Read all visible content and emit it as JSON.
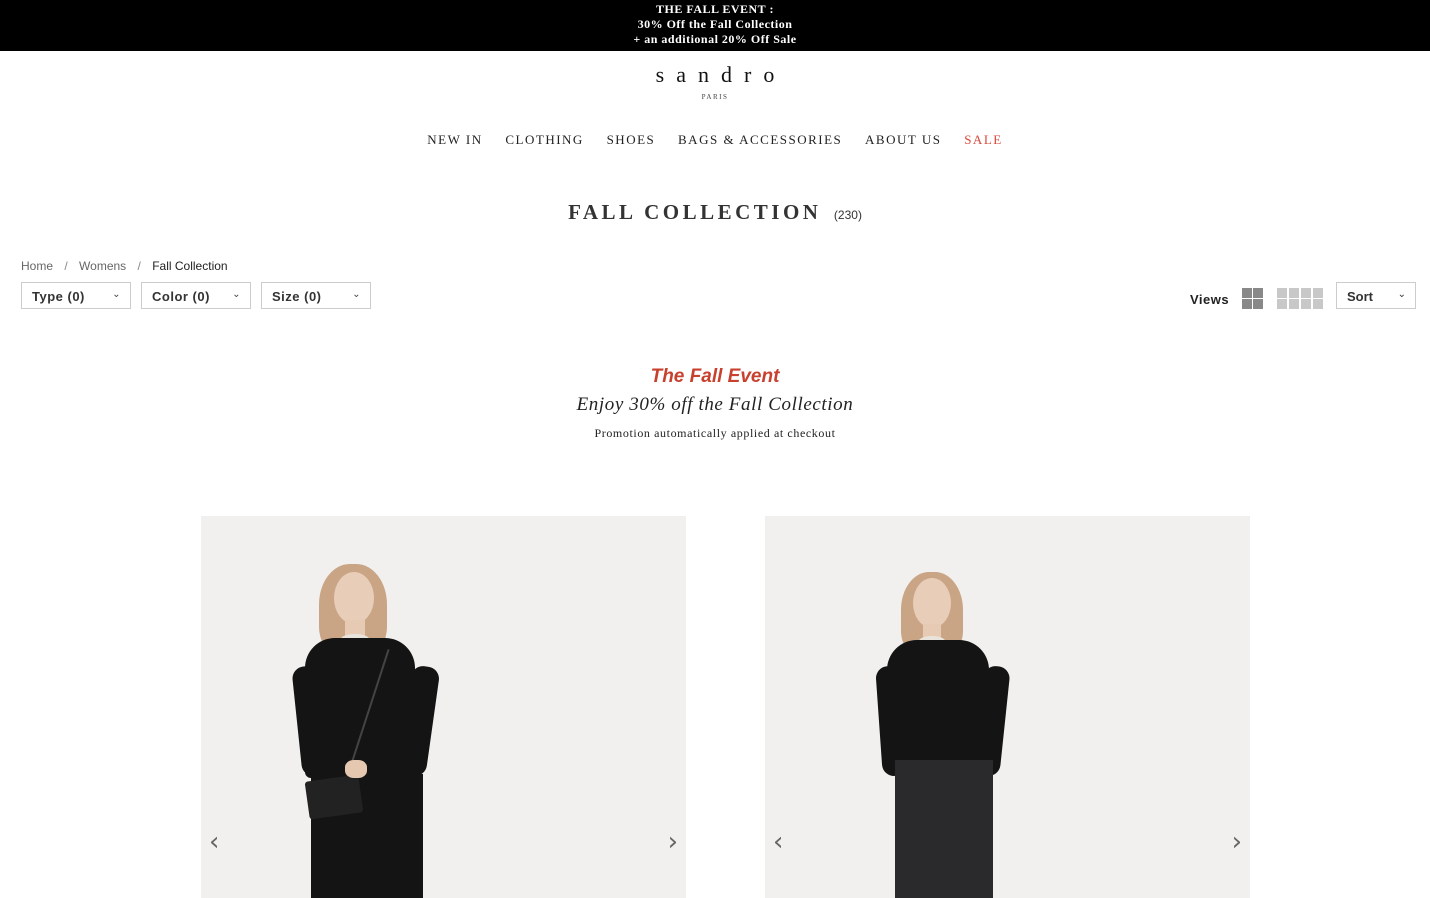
{
  "promo": {
    "line1": "THE FALL EVENT :",
    "line2": "30% Off the Fall Collection",
    "line3": "+ an additional 20% Off Sale"
  },
  "logo": {
    "brand": "sandro",
    "sub": "PARIS"
  },
  "nav": {
    "items": [
      {
        "label": "NEW IN"
      },
      {
        "label": "CLOTHING"
      },
      {
        "label": "SHOES"
      },
      {
        "label": "BAGS & ACCESSORIES"
      },
      {
        "label": "ABOUT US"
      },
      {
        "label": "SALE"
      }
    ]
  },
  "page": {
    "title": "FALL COLLECTION",
    "count": "(230)"
  },
  "breadcrumb": {
    "items": [
      {
        "label": "Home"
      },
      {
        "label": "Womens"
      },
      {
        "label": "Fall Collection"
      }
    ],
    "separator": "/"
  },
  "filters": [
    {
      "label": "Type (0)"
    },
    {
      "label": "Color (0)"
    },
    {
      "label": "Size (0)"
    }
  ],
  "views": {
    "label": "Views"
  },
  "sort": {
    "label": "Sort"
  },
  "event": {
    "heading": "The Fall Event",
    "subheading": "Enjoy 30% off the Fall Collection",
    "note": "Promotion automatically applied at checkout"
  },
  "icons": {
    "chevron": "⌄",
    "prev": "‹",
    "next": "›"
  },
  "colors": {
    "accent": "#d9483b",
    "event_red": "#c8402e",
    "promo_bg": "#000000"
  }
}
